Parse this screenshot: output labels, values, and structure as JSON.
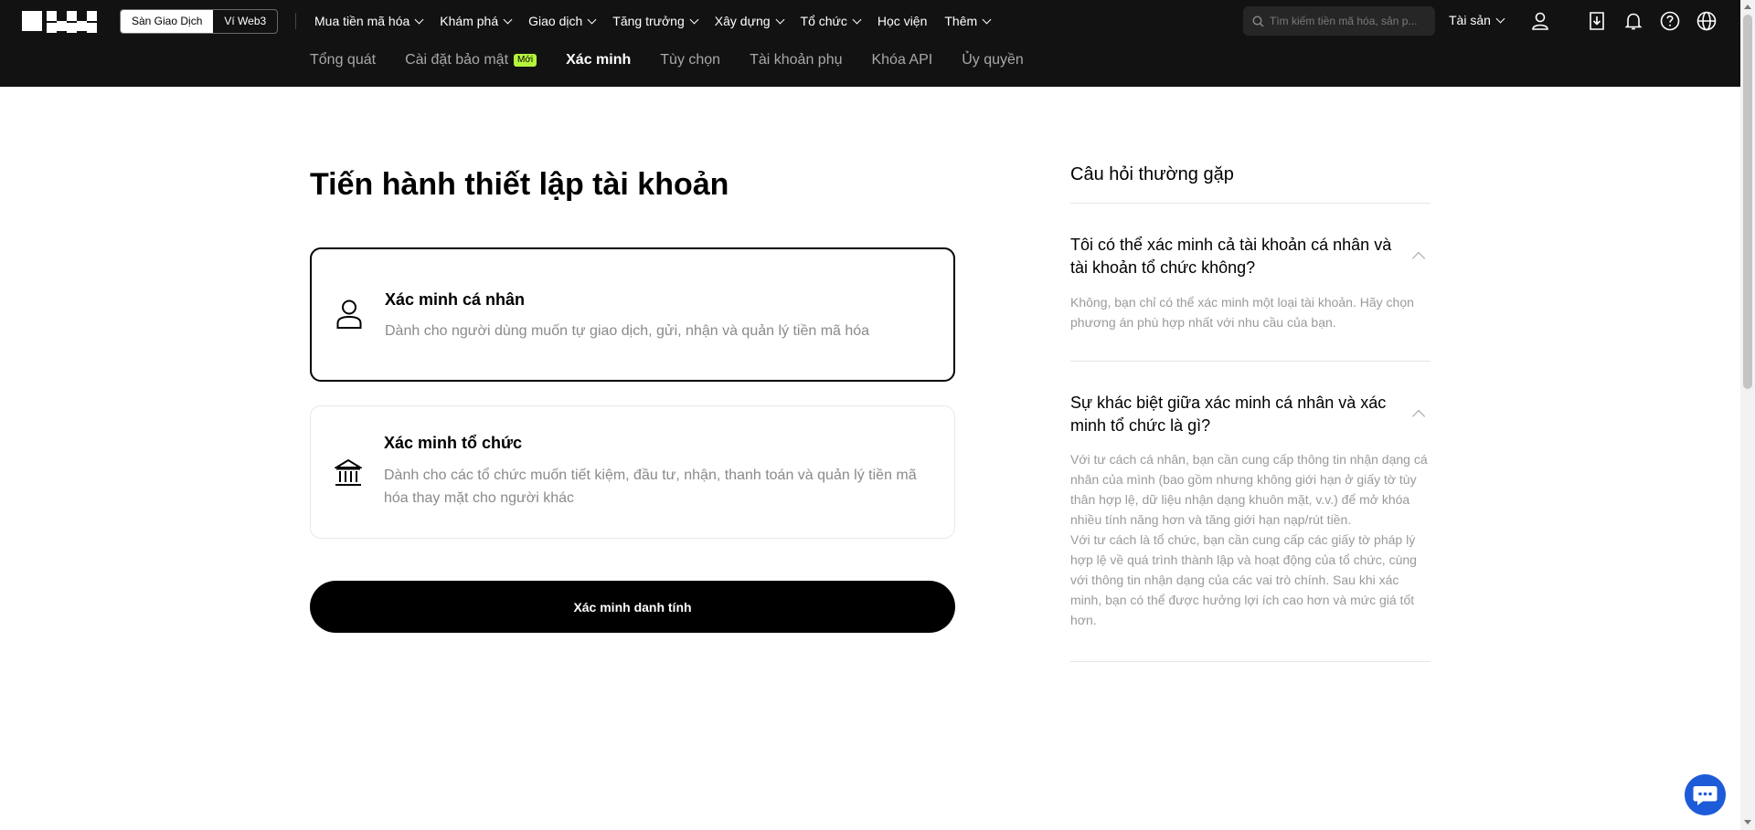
{
  "topbar": {
    "switcher": {
      "exchange": "Sàn Giao Dịch",
      "web3": "Ví Web3"
    },
    "nav": [
      {
        "label": "Mua tiền mã hóa",
        "dropdown": true
      },
      {
        "label": "Khám phá",
        "dropdown": true
      },
      {
        "label": "Giao dịch",
        "dropdown": true
      },
      {
        "label": "Tăng trưởng",
        "dropdown": true
      },
      {
        "label": "Xây dựng",
        "dropdown": true
      },
      {
        "label": "Tổ chức",
        "dropdown": true
      },
      {
        "label": "Học viện",
        "dropdown": false
      },
      {
        "label": "Thêm",
        "dropdown": true
      }
    ],
    "search_placeholder": "Tìm kiếm tiền mã hóa, sản p...",
    "assets_label": "Tài sản",
    "icons": [
      "user-icon",
      "download-icon",
      "bell-icon",
      "help-icon",
      "globe-icon"
    ]
  },
  "subnav": [
    {
      "label": "Tổng quát"
    },
    {
      "label": "Cài đặt bảo mật",
      "badge": "Mới"
    },
    {
      "label": "Xác minh",
      "active": true
    },
    {
      "label": "Tùy chọn"
    },
    {
      "label": "Tài khoản phụ"
    },
    {
      "label": "Khóa API"
    },
    {
      "label": "Ủy quyền"
    }
  ],
  "main": {
    "heading": "Tiến hành thiết lập tài khoản",
    "cards": [
      {
        "title": "Xác minh cá nhân",
        "desc": "Dành cho người dùng muốn tự giao dịch, gửi, nhận và quản lý tiền mã hóa",
        "icon": "person-icon",
        "selected": true
      },
      {
        "title": "Xác minh tổ chức",
        "desc": "Dành cho các tổ chức muốn tiết kiệm, đầu tư, nhận, thanh toán và quản lý tiền mã hóa thay mặt cho người khác",
        "icon": "bank-icon",
        "selected": false
      }
    ],
    "cta": "Xác minh danh tính"
  },
  "faq": {
    "title": "Câu hỏi thường gặp",
    "items": [
      {
        "q": "Tôi có thể xác minh cả tài khoản cá nhân và tài khoản tổ chức không?",
        "a": "Không, bạn chỉ có thể xác minh một loại tài khoản. Hãy chọn phương án phù hợp nhất với nhu cầu của bạn."
      },
      {
        "q": "Sự khác biệt giữa xác minh cá nhân và xác minh tổ chức là gì?",
        "a": "Với tư cách cá nhân, bạn cần cung cấp thông tin nhận dạng cá nhân của mình (bao gồm nhưng không giới hạn ở giấy tờ tùy thân hợp lệ, dữ liệu nhận dạng khuôn mặt, v.v.) để mở khóa nhiều tính năng hơn và tăng giới hạn nạp/rút tiền.",
        "a2": "Với tư cách là tổ chức, bạn cần cung cấp các giấy tờ pháp lý hợp lệ về quá trình thành lập và hoạt động của tổ chức, cùng với thông tin nhận dạng của các vai trò chính. Sau khi xác minh, bạn có thể được hưởng lợi ích cao hơn và mức giá tốt hơn."
      }
    ]
  },
  "colors": {
    "topbar": "#121212",
    "accent_badge": "#b5f33d",
    "chat": "#1d5bd8"
  }
}
